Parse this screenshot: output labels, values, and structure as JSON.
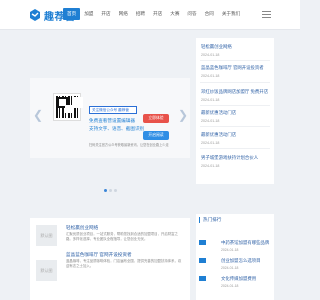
{
  "brand": {
    "name": "趣荐营",
    "color": "#1f7fd3"
  },
  "nav": {
    "items": [
      "首页",
      "加盟",
      "开店",
      "网络",
      "招聘",
      "开店",
      "大赛",
      "问答",
      "合同",
      "关于我们"
    ]
  },
  "banner": {
    "search_text": "关注微信公众号 趣荐营",
    "line1": "免费查看营设置编辑器",
    "line2": "支持文字、语音、截图识别",
    "note": "扫码关注官方公众号获取最新资讯，让您在创业路上少走弯路...",
    "btn_primary": "立即体验",
    "btn_secondary": "开启阅读"
  },
  "side_list": [
    {
      "title": "轻松赢创业网络",
      "date": "2024-01-18"
    },
    {
      "title": "蓝晶蓝色咖啡厅 官网开设投资者",
      "date": "2024-01-18"
    },
    {
      "title": "邓红炒饭品牌网店加盟厅 免费开店",
      "date": "2024-01-18"
    },
    {
      "title": "最新优惠活动门店",
      "date": "2024-01-18"
    },
    {
      "title": "最新优惠活动门店",
      "date": "2024-01-18"
    },
    {
      "title": "男子城堡游戏扶持计划合伙人 ",
      "date": "2024-01-18"
    }
  ],
  "cards": [
    {
      "thumb": "默认图",
      "title": "轻松赢创业网络",
      "desc": "汇聚优质创业项目，一站式服务，帮助您找到合适的加盟项目，开启财富之路。多样化选择，专业团队全程指导，让您创业无忧。",
      "meta": "2024-01-18"
    },
    {
      "thumb": "默认图",
      "title": "蓝晶蓝色咖啡厅 官网开设投资者",
      "desc": "蓝晶咖啡，专注品质咖啡体验，门店遍布全国，提供完善的加盟扶持体系，欢迎有志之士加入。",
      "meta": "2024-01-18"
    }
  ],
  "hot": {
    "heading": "热门排行",
    "items": [
      {
        "title": "中药茶馆加盟有哪些品牌",
        "date": "2024-01-18"
      },
      {
        "title": "创业加盟怎么选项目",
        "date": "2024-01-18"
      },
      {
        "title": "文化传媒加盟费用",
        "date": "2024-01-18"
      }
    ]
  }
}
